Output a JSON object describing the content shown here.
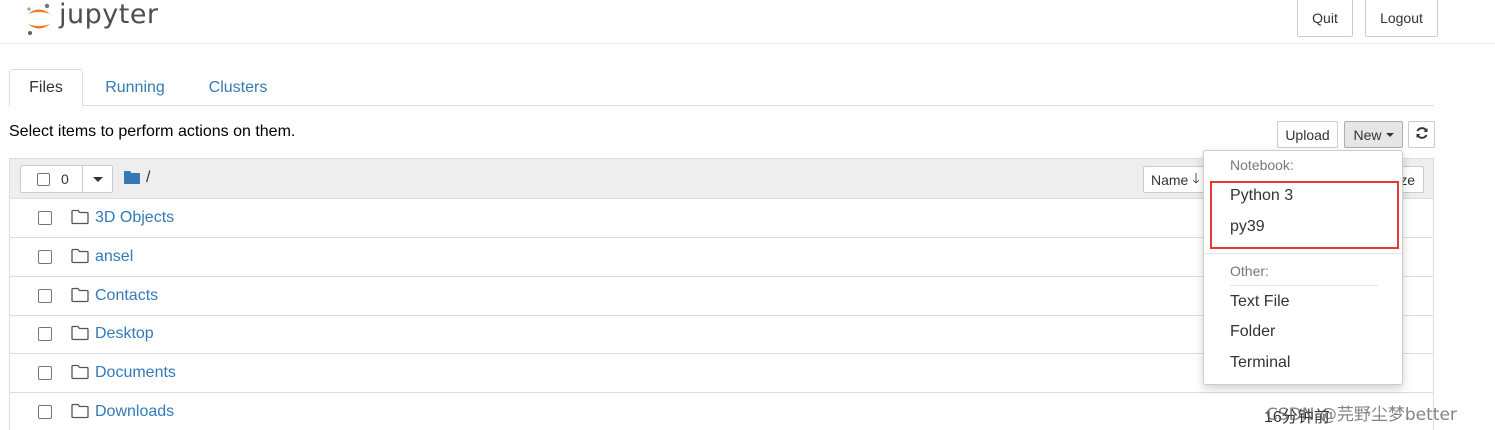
{
  "header": {
    "logo_text": "jupyter",
    "quit_label": "Quit",
    "logout_label": "Logout"
  },
  "tabs": [
    {
      "label": "Files",
      "active": true
    },
    {
      "label": "Running",
      "active": false
    },
    {
      "label": "Clusters",
      "active": false
    }
  ],
  "toolbar": {
    "hint": "Select items to perform actions on them.",
    "upload_label": "Upload",
    "new_label": "New",
    "refresh_icon": "refresh-icon"
  },
  "list_header": {
    "selected_count": "0",
    "path": "/",
    "sort_name_label": "Name",
    "sort_size_label": "ze"
  },
  "files": [
    {
      "name": "3D Objects",
      "modified": ""
    },
    {
      "name": "ansel",
      "modified": ""
    },
    {
      "name": "Contacts",
      "modified": ""
    },
    {
      "name": "Desktop",
      "modified": ""
    },
    {
      "name": "Documents",
      "modified": ""
    },
    {
      "name": "Downloads",
      "modified": "16分钟前"
    }
  ],
  "new_menu": {
    "notebook_header": "Notebook:",
    "notebook_items": [
      "Python 3",
      "py39"
    ],
    "other_header": "Other:",
    "other_items": [
      "Text File",
      "Folder",
      "Terminal"
    ]
  },
  "colors": {
    "link": "#337ab7",
    "highlight_box": "#e53935",
    "logo_orange": "#f37726"
  },
  "watermark": "CSDN @芫野尘梦better"
}
